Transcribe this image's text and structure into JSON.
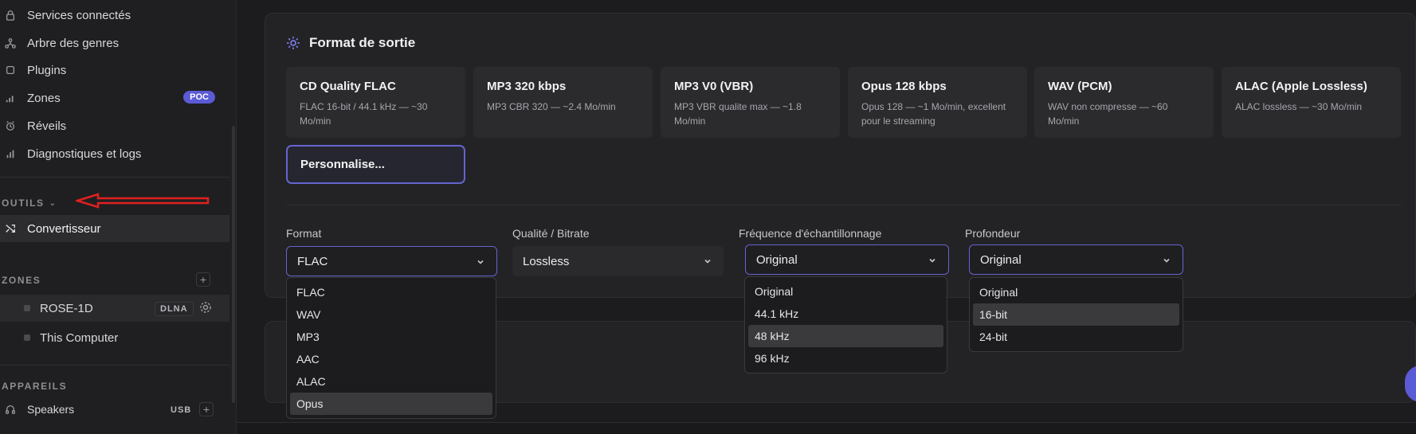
{
  "sidebar": {
    "nav": [
      {
        "label": "Services connectés",
        "icon": "lock-icon"
      },
      {
        "label": "Arbre des genres",
        "icon": "tree-icon"
      },
      {
        "label": "Plugins",
        "icon": "plugin-icon"
      },
      {
        "label": "Zones",
        "icon": "bars-icon",
        "badge": "POC"
      },
      {
        "label": "Réveils",
        "icon": "alarm-clock-icon"
      },
      {
        "label": "Diagnostiques et logs",
        "icon": "chart-icon"
      }
    ],
    "tools_header": "OUTILS",
    "tools": [
      {
        "label": "Convertisseur",
        "icon": "shuffle-icon"
      }
    ],
    "zones_header": "ZONES",
    "zones": [
      {
        "label": "ROSE-1D",
        "chip": "DLNA"
      },
      {
        "label": "This Computer"
      }
    ],
    "devices_header": "APPAREILS",
    "devices": [
      {
        "label": "Speakers",
        "chip": "USB"
      }
    ]
  },
  "output": {
    "title": "Format de sortie",
    "presets": [
      {
        "name": "CD Quality FLAC",
        "desc": "FLAC 16-bit / 44.1 kHz — ~30 Mo/min"
      },
      {
        "name": "MP3 320 kbps",
        "desc": "MP3 CBR 320 — ~2.4 Mo/min"
      },
      {
        "name": "MP3 V0 (VBR)",
        "desc": "MP3 VBR qualite max — ~1.8 Mo/min"
      },
      {
        "name": "Opus 128 kbps",
        "desc": "Opus 128 — ~1 Mo/min, excellent pour le streaming"
      },
      {
        "name": "WAV (PCM)",
        "desc": "WAV non compresse — ~60 Mo/min"
      },
      {
        "name": "ALAC (Apple Lossless)",
        "desc": "ALAC lossless — ~30 Mo/min"
      }
    ],
    "custom_label": "Personnalise...",
    "fields": {
      "format": {
        "label": "Format",
        "value": "FLAC",
        "options": [
          "FLAC",
          "WAV",
          "MP3",
          "AAC",
          "ALAC",
          "Opus"
        ],
        "highlighted": "Opus"
      },
      "quality": {
        "label": "Qualité / Bitrate",
        "value": "Lossless"
      },
      "samplerate": {
        "label": "Fréquence d'échantillonnage",
        "value": "Original",
        "options": [
          "Original",
          "44.1 kHz",
          "48 kHz",
          "96 kHz"
        ],
        "highlighted": "48 kHz"
      },
      "depth": {
        "label": "Profondeur",
        "value": "Original",
        "options": [
          "Original",
          "16-bit",
          "24-bit"
        ],
        "highlighted": "16-bit"
      }
    }
  },
  "colors": {
    "accent": "#5b5bd6",
    "annotation_arrow": "#e02020"
  }
}
